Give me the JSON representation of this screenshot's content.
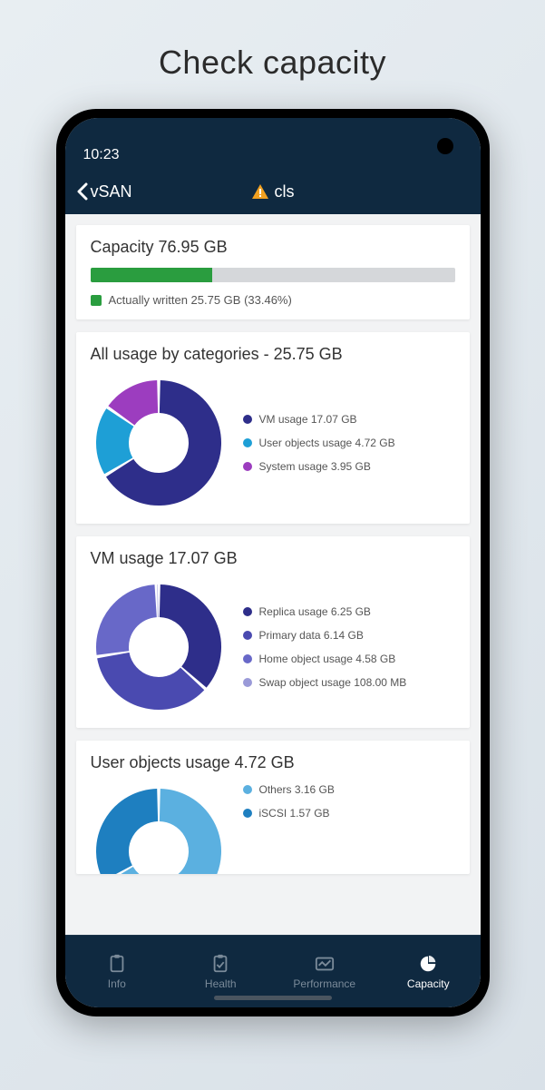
{
  "page_heading": "Check capacity",
  "status": {
    "time": "10:23"
  },
  "nav": {
    "back_label": "vSAN",
    "title": "cls"
  },
  "capacity_card": {
    "title": "Capacity 76.95 GB",
    "fill_percent": 33.46,
    "legend": "Actually written 25.75 GB (33.46%)",
    "fill_color": "#2a9d3f"
  },
  "all_usage_card": {
    "title": "All usage by categories -  25.75 GB",
    "items": [
      {
        "label": "VM usage 17.07 GB",
        "color": "#2e2e8a",
        "value": 17.07
      },
      {
        "label": "User objects usage 4.72 GB",
        "color": "#1e9fd6",
        "value": 4.72
      },
      {
        "label": "System usage 3.95 GB",
        "color": "#9c3dbf",
        "value": 3.95
      }
    ]
  },
  "vm_usage_card": {
    "title": "VM usage 17.07 GB",
    "items": [
      {
        "label": "Replica usage 6.25 GB",
        "color": "#2e2e8a",
        "value": 6.25
      },
      {
        "label": "Primary data 6.14 GB",
        "color": "#4a4ab0",
        "value": 6.14
      },
      {
        "label": "Home object usage 4.58 GB",
        "color": "#6868c8",
        "value": 4.58
      },
      {
        "label": "Swap object usage 108.00 MB",
        "color": "#9a9ad8",
        "value": 0.108
      }
    ]
  },
  "user_objects_card": {
    "title": "User objects usage 4.72 GB",
    "items": [
      {
        "label": "Others 3.16 GB",
        "color": "#5bb0e0",
        "value": 3.16
      },
      {
        "label": "iSCSI 1.57 GB",
        "color": "#1e7fc0",
        "value": 1.57
      }
    ]
  },
  "tabs": {
    "items": [
      {
        "label": "Info",
        "active": false
      },
      {
        "label": "Health",
        "active": false
      },
      {
        "label": "Performance",
        "active": false
      },
      {
        "label": "Capacity",
        "active": true
      }
    ]
  },
  "chart_data": [
    {
      "type": "bar",
      "title": "Capacity 76.95 GB",
      "categories": [
        "Actually written"
      ],
      "values": [
        25.75
      ],
      "xlabel": "",
      "ylabel": "GB",
      "ylim": [
        0,
        76.95
      ]
    },
    {
      "type": "pie",
      "title": "All usage by categories - 25.75 GB",
      "series": [
        {
          "name": "VM usage",
          "value": 17.07
        },
        {
          "name": "User objects usage",
          "value": 4.72
        },
        {
          "name": "System usage",
          "value": 3.95
        }
      ]
    },
    {
      "type": "pie",
      "title": "VM usage 17.07 GB",
      "series": [
        {
          "name": "Replica usage",
          "value": 6.25
        },
        {
          "name": "Primary data",
          "value": 6.14
        },
        {
          "name": "Home object usage",
          "value": 4.58
        },
        {
          "name": "Swap object usage",
          "value": 0.108
        }
      ]
    },
    {
      "type": "pie",
      "title": "User objects usage 4.72 GB",
      "series": [
        {
          "name": "Others",
          "value": 3.16
        },
        {
          "name": "iSCSI",
          "value": 1.57
        }
      ]
    }
  ]
}
